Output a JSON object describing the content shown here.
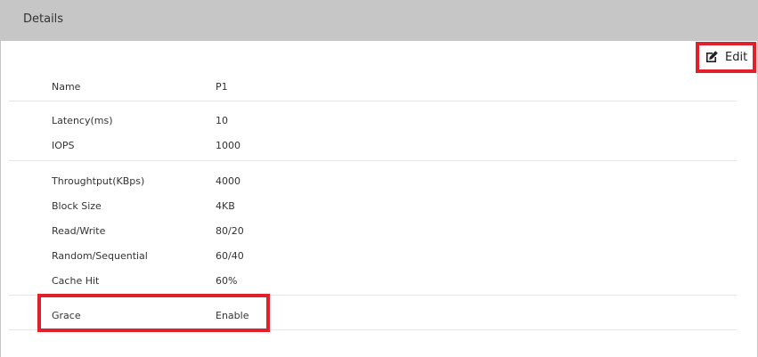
{
  "panel": {
    "title": "Details"
  },
  "toolbar": {
    "edit_label": "Edit",
    "edit_icon": "edit-icon"
  },
  "fields": [
    {
      "label": "Name",
      "value": "P1"
    },
    {
      "label": "Latency(ms)",
      "value": "10"
    },
    {
      "label": "IOPS",
      "value": "1000"
    },
    {
      "label": "Throughtput(KBps)",
      "value": "4000"
    },
    {
      "label": "Block Size",
      "value": "4KB"
    },
    {
      "label": "Read/Write",
      "value": "80/20"
    },
    {
      "label": "Random/Sequential",
      "value": "60/40"
    },
    {
      "label": "Cache Hit",
      "value": "60%"
    },
    {
      "label": "Grace",
      "value": "Enable"
    }
  ],
  "colors": {
    "header_bg": "#c6c6c6",
    "highlight": "#e0202a",
    "divider": "#e6e6e6"
  }
}
